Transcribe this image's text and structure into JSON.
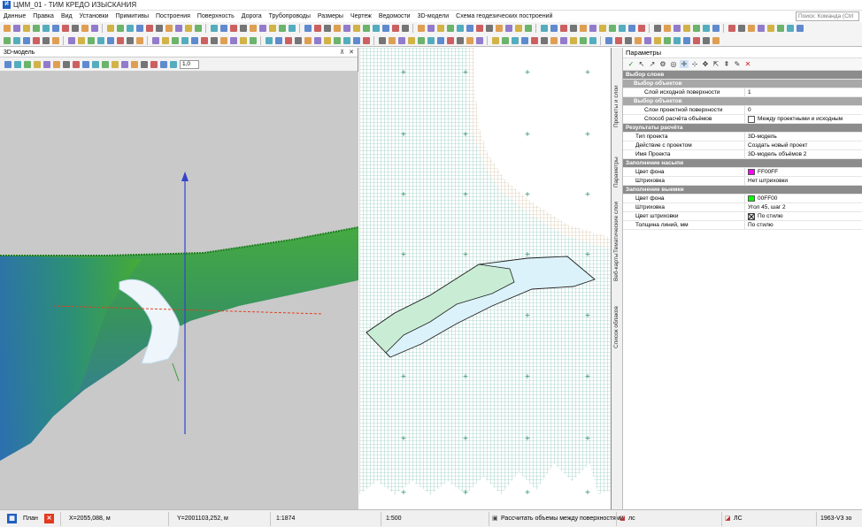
{
  "app": {
    "icon_letter": "И",
    "title": "ЦММ_01 - ТИМ КРЕДО ИЗЫСКАНИЯ"
  },
  "menu": {
    "items": [
      "Данные",
      "Правка",
      "Вид",
      "Установки",
      "Примитивы",
      "Построения",
      "Поверхность",
      "Дорога",
      "Трубопроводы",
      "Размеры",
      "Чертеж",
      "Ведомости",
      "3D-модели",
      "Схема геодезических построений"
    ],
    "search_placeholder": "Поиск: Команда (Ctrl"
  },
  "panel3d": {
    "title": "3D-модель",
    "pin_icon": "pin-icon",
    "close_icon": "close-icon",
    "zoom_value": "1,0"
  },
  "vertical_tabs": [
    "Проекты и слои",
    "Параметры",
    "Тематические слои",
    "Веб-карты",
    "Список облаков"
  ],
  "params": {
    "title": "Параметры",
    "sections": {
      "layers": "Выбор слоев",
      "objects1": "Выбор объектов",
      "source_layer_label": "Слой исходной поверхности",
      "source_layer_value": "1",
      "objects2": "Выбор объектов",
      "project_layers_label": "Слои проектной поверхности",
      "project_layers_value": "0",
      "calc_method_label": "Способ расчёта объёмов",
      "calc_method_value": "Между проектными и исходным",
      "results": "Результаты расчёта",
      "project_type_label": "Тип проекта",
      "project_type_value": "3D-модель",
      "action_label": "Действие с проектом",
      "action_value": "Создать новый проект",
      "project_name_label": "Имя Проекта",
      "project_name_value": "3D-модель объёмов 2",
      "fill_section": "Заполнение насыпи",
      "fill_color_label": "Цвет фона",
      "fill_color_value": "FF00FF",
      "fill_hatch_label": "Штриховка",
      "fill_hatch_value": "Нет штриховки",
      "cut_section": "Заполнение выемки",
      "cut_color_label": "Цвет фона",
      "cut_color_value": "00FF00",
      "cut_hatch_label": "Штриховка",
      "cut_hatch_value": "Угол 45, шаг 2",
      "hatch_color_label": "Цвет штриховки",
      "hatch_color_value": "По стилю",
      "line_width_label": "Толщина линий, мм",
      "line_width_value": "По стилю"
    }
  },
  "colors": {
    "fill_swatch": "#FF00FF",
    "cut_swatch": "#00FF00",
    "axis_blue": "#3344cc",
    "axis_red": "#e04020",
    "surface_green": "#2fa33a",
    "surface_blue": "#2b6fb0"
  },
  "statusbar": {
    "mode": "План",
    "x_coord": "X=2055,088, м",
    "y_coord": "Y=2001103,252, м",
    "scale1": "1:1874",
    "scale2": "1:500",
    "command": "Рассчитать объемы между поверхностями",
    "layer1": "лс",
    "layer2": "ЛС",
    "version": "1963-V3 зо"
  }
}
